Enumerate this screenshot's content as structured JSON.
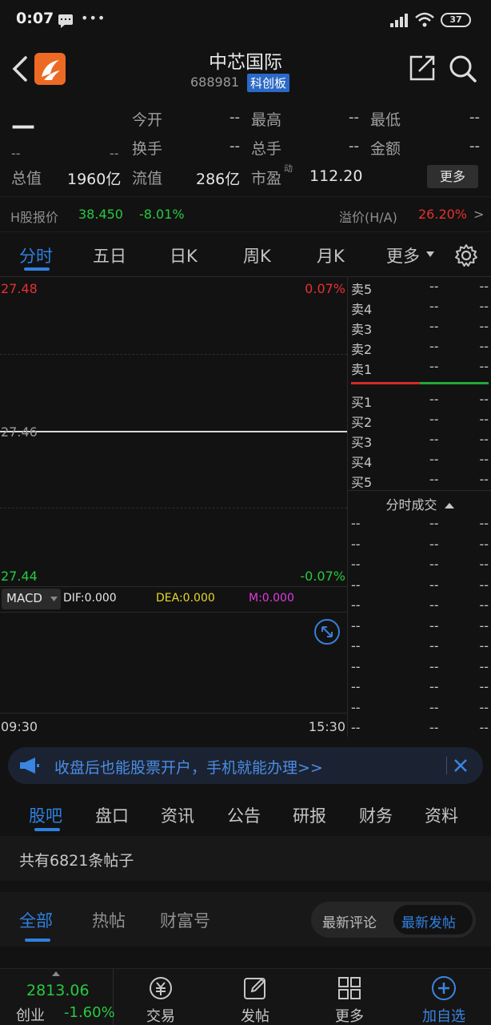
{
  "status_bar": {
    "time": "0:07",
    "battery": "37"
  },
  "header": {
    "name": "中芯国际",
    "code": "688981",
    "board": "科创板"
  },
  "quote": {
    "price": "—",
    "change": "--",
    "change_pct": "--",
    "rows": [
      [
        {
          "label": "今开",
          "value": "--"
        },
        {
          "label": "最高",
          "value": "--"
        },
        {
          "label": "最低",
          "value": "--"
        }
      ],
      [
        {
          "label": "换手",
          "value": "--"
        },
        {
          "label": "总手",
          "value": "--"
        },
        {
          "label": "金额",
          "value": "--"
        }
      ]
    ],
    "total_cap_label": "总值",
    "total_cap": "1960亿",
    "float_cap_label": "流值",
    "float_cap": "286亿",
    "pe_label": "市盈",
    "pe_sup": "动",
    "pe": "112.20",
    "more": "更多"
  },
  "h_share": {
    "label": "H股报价",
    "price": "38.450",
    "change_pct": "-8.01%",
    "premium_label": "溢价(H/A)",
    "premium": "26.20%",
    "arrow": ">"
  },
  "period_tabs": {
    "items": [
      "分时",
      "五日",
      "日K",
      "周K",
      "月K",
      "更多"
    ],
    "selected": "分时"
  },
  "chart": {
    "price_high": "27.48",
    "price_mid": "27.46",
    "price_low": "27.44",
    "pct_high": "0.07%",
    "pct_low": "-0.07%",
    "time_start": "09:30",
    "time_end": "15:30",
    "macd": {
      "name": "MACD",
      "dif": "DIF:0.000",
      "dea": "DEA:0.000",
      "m": "M:0.000"
    }
  },
  "order_book": {
    "sells": [
      {
        "label": "卖5",
        "price": "--",
        "vol": "--"
      },
      {
        "label": "卖4",
        "price": "--",
        "vol": "--"
      },
      {
        "label": "卖3",
        "price": "--",
        "vol": "--"
      },
      {
        "label": "卖2",
        "price": "--",
        "vol": "--"
      },
      {
        "label": "卖1",
        "price": "--",
        "vol": "--"
      }
    ],
    "buys": [
      {
        "label": "买1",
        "price": "--",
        "vol": "--"
      },
      {
        "label": "买2",
        "price": "--",
        "vol": "--"
      },
      {
        "label": "买3",
        "price": "--",
        "vol": "--"
      },
      {
        "label": "买4",
        "price": "--",
        "vol": "--"
      },
      {
        "label": "买5",
        "price": "--",
        "vol": "--"
      }
    ],
    "trades_title": "分时成交",
    "trades": [
      {
        "a": "--",
        "b": "--",
        "c": "--"
      },
      {
        "a": "--",
        "b": "--",
        "c": "--"
      },
      {
        "a": "--",
        "b": "--",
        "c": "--"
      },
      {
        "a": "--",
        "b": "--",
        "c": "--"
      },
      {
        "a": "--",
        "b": "--",
        "c": "--"
      },
      {
        "a": "--",
        "b": "--",
        "c": "--"
      },
      {
        "a": "--",
        "b": "--",
        "c": "--"
      },
      {
        "a": "--",
        "b": "--",
        "c": "--"
      },
      {
        "a": "--",
        "b": "--",
        "c": "--"
      },
      {
        "a": "--",
        "b": "--",
        "c": "--"
      },
      {
        "a": "--",
        "b": "--",
        "c": "--"
      }
    ]
  },
  "banner": {
    "text": "收盘后也能股票开户，手机就能办理>>"
  },
  "info_tabs": {
    "items": [
      "股吧",
      "盘口",
      "资讯",
      "公告",
      "研报",
      "财务",
      "资料"
    ],
    "selected": "股吧"
  },
  "posts": {
    "count_text": "共有6821条帖子"
  },
  "sub_tabs": {
    "items": [
      "全部",
      "热帖",
      "财富号"
    ],
    "sort_options": [
      "最新评论",
      "最新发帖"
    ],
    "selected_sort": "最新发帖"
  },
  "bottom_nav": {
    "index_value": "2813.06",
    "index_name": "创业",
    "index_change": "-1.60%",
    "items": [
      "交易",
      "发帖",
      "更多",
      "加自选"
    ]
  },
  "colors": {
    "up": "#e82f2f",
    "down": "#27c93f",
    "accent": "#2f80e0"
  }
}
